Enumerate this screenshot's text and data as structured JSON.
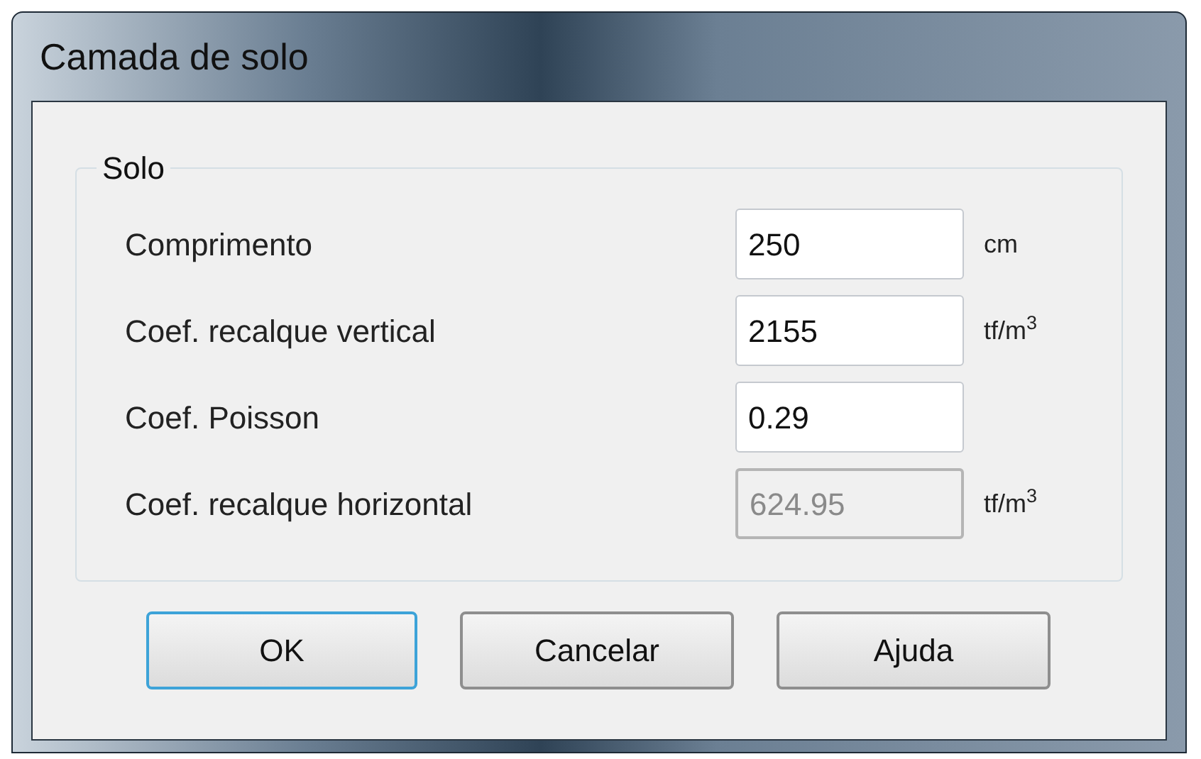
{
  "window": {
    "title": "Camada de solo"
  },
  "group": {
    "title": "Solo"
  },
  "fields": [
    {
      "label": "Comprimento",
      "value": "250",
      "unit": "cm",
      "disabled": false
    },
    {
      "label": "Coef. recalque vertical",
      "value": "2155",
      "unit": "tf/m$^{3}$",
      "disabled": false
    },
    {
      "label": "Coef. Poisson",
      "value": "0.29",
      "disabled": false
    },
    {
      "label": "Coef. recalque horizontal",
      "value": "624.95",
      "unit": "tf/m$^{3}$",
      "disabled": true
    }
  ],
  "buttons": [
    {
      "label": "OK",
      "default": true
    },
    {
      "label": "Cancelar",
      "default": false
    },
    {
      "label": "Ajuda",
      "default": false
    }
  ]
}
